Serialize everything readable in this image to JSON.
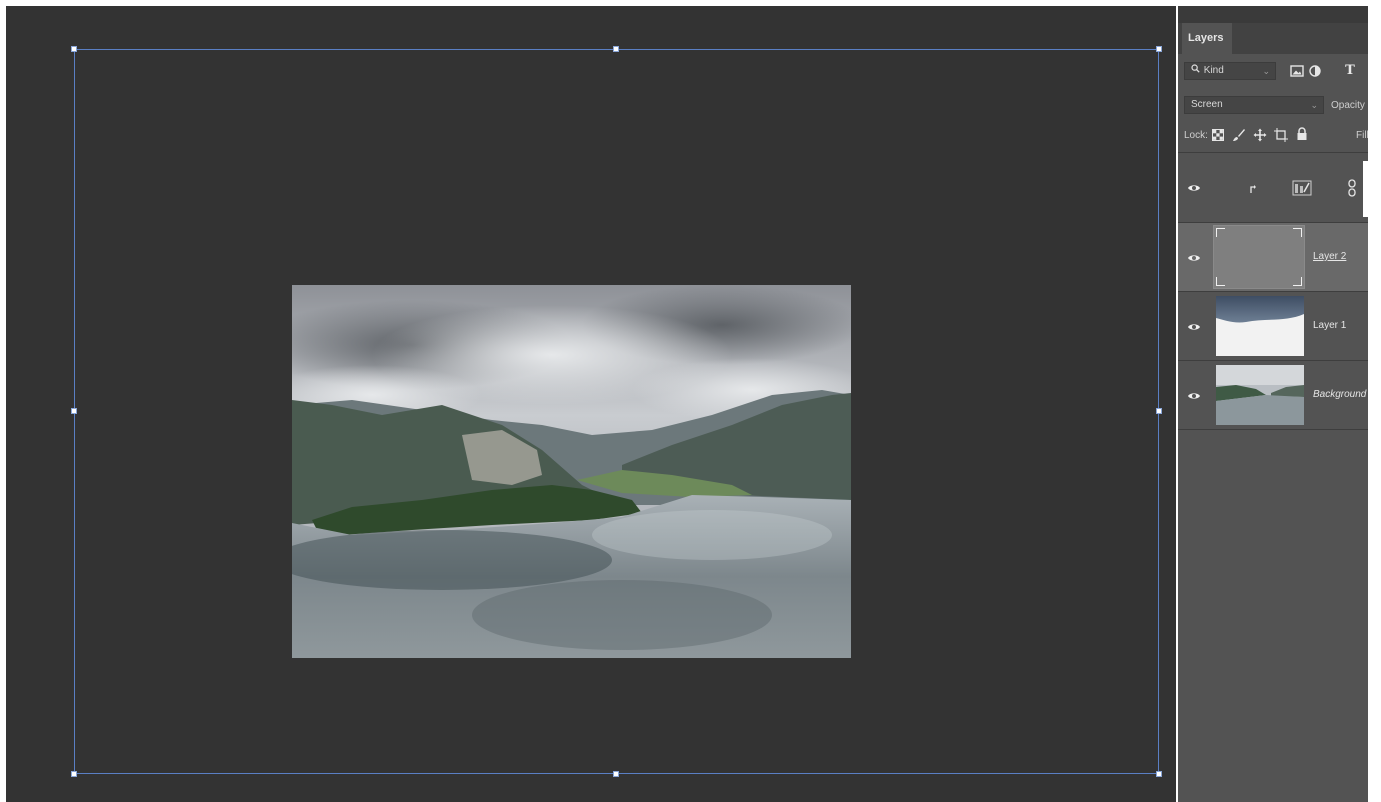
{
  "layers_panel": {
    "tab_label": "Layers",
    "filter": {
      "value": "Kind",
      "icons": [
        "image-filter-icon",
        "adjustment-filter-icon",
        "type-filter-icon"
      ]
    },
    "blend_mode": {
      "value": "Screen",
      "opacity_label": "Opacity"
    },
    "lock": {
      "label": "Lock:",
      "icons": [
        "lock-transparent-icon",
        "lock-paint-icon",
        "lock-move-icon",
        "lock-artboard-icon",
        "lock-all-icon"
      ],
      "fill_label": "Fill"
    },
    "layers": [
      {
        "name": "",
        "kind": "adjustment",
        "visible": true,
        "selected": false
      },
      {
        "name": "Layer 2",
        "kind": "gray-fill",
        "visible": true,
        "selected": true
      },
      {
        "name": "Layer 1",
        "kind": "sky",
        "visible": true,
        "selected": false
      },
      {
        "name": "Background",
        "kind": "photo",
        "visible": true,
        "selected": false
      }
    ]
  },
  "colors": {
    "canvas_bg": "#333333",
    "panel_bg": "#535353",
    "selected_row": "#696969",
    "transform_box": "#5a7fc4"
  }
}
